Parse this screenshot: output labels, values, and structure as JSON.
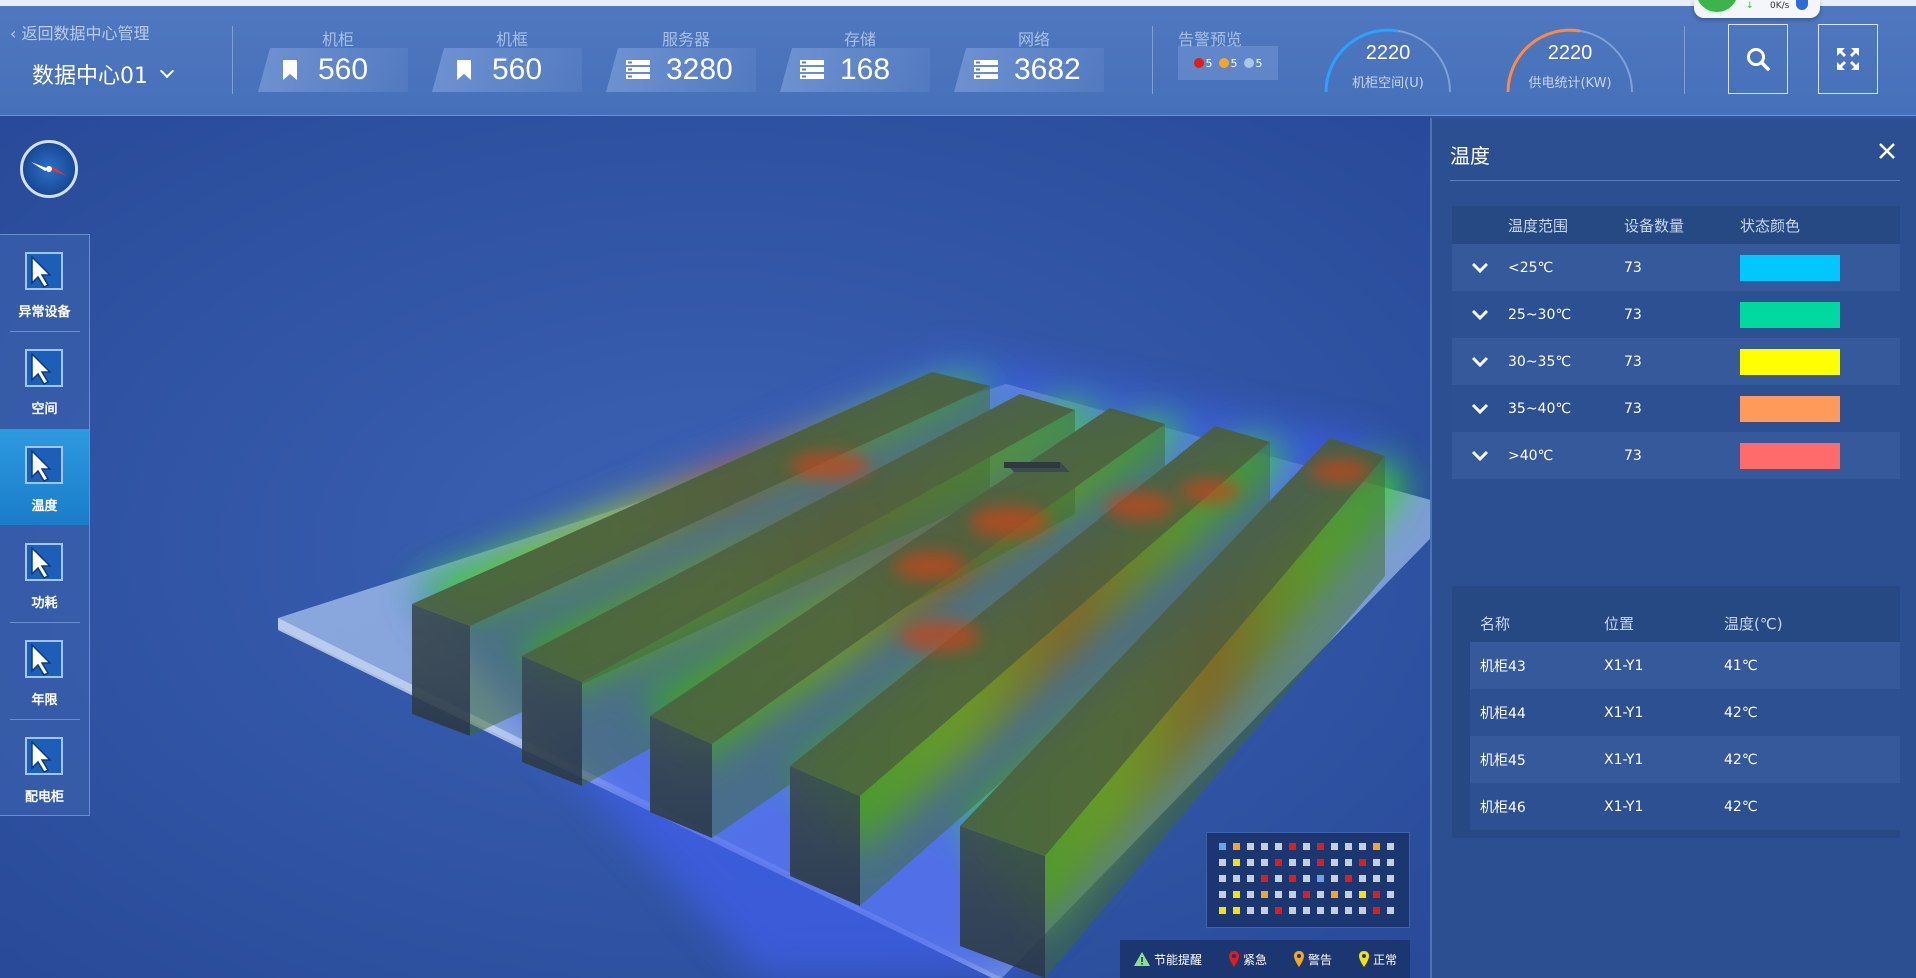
{
  "header": {
    "back_link": "返回数据中心管理",
    "datacenter": "数据中心01",
    "stats": [
      {
        "label": "机柜",
        "value": "560",
        "icon": "bookmark-icon"
      },
      {
        "label": "机框",
        "value": "560",
        "icon": "bookmark-icon"
      },
      {
        "label": "服务器",
        "value": "3280",
        "icon": "server-icon"
      },
      {
        "label": "存储",
        "value": "168",
        "icon": "storage-icon"
      },
      {
        "label": "网络",
        "value": "3682",
        "icon": "network-icon"
      }
    ],
    "alarm": {
      "title": "告警预览",
      "items": [
        {
          "count": "5",
          "color": "#e21b1b"
        },
        {
          "count": "5",
          "color": "#f5a623"
        },
        {
          "count": "5",
          "color": "#a9c7e6"
        }
      ]
    },
    "gauges": [
      {
        "value": "2220",
        "label": "机柜空间(U)",
        "color": "#2ea0ff"
      },
      {
        "value": "2220",
        "label": "供电统计(KW)",
        "color": "#ff8a3d"
      }
    ],
    "speed_text": "0K/s"
  },
  "sidenav": {
    "items": [
      {
        "label": "异常设备",
        "active": false
      },
      {
        "label": "空间",
        "active": false
      },
      {
        "label": "温度",
        "active": true
      },
      {
        "label": "功耗",
        "active": false
      },
      {
        "label": "年限",
        "active": false
      },
      {
        "label": "配电柜",
        "active": false
      }
    ]
  },
  "panel": {
    "title": "温度",
    "range_table": {
      "headers": [
        "温度范围",
        "设备数量",
        "状态颜色"
      ],
      "rows": [
        {
          "range": "<25℃",
          "count": "73",
          "color": "#00c8ff"
        },
        {
          "range": "25~30℃",
          "count": "73",
          "color": "#00d8a0"
        },
        {
          "range": "30~35℃",
          "count": "73",
          "color": "#ffff00"
        },
        {
          "range": "35~40℃",
          "count": "73",
          "color": "#ff9a5a"
        },
        {
          "range": ">40℃",
          "count": "73",
          "color": "#ff6b6b"
        }
      ]
    },
    "cabinet_table": {
      "headers": [
        "名称",
        "位置",
        "温度(℃)"
      ],
      "rows": [
        {
          "name": "机柜43",
          "pos": "X1-Y1",
          "temp": "41℃"
        },
        {
          "name": "机柜44",
          "pos": "X1-Y1",
          "temp": "42℃"
        },
        {
          "name": "机柜45",
          "pos": "X1-Y1",
          "temp": "42℃"
        },
        {
          "name": "机柜46",
          "pos": "X1-Y1",
          "temp": "42℃"
        }
      ]
    }
  },
  "legend": {
    "items": [
      {
        "label": "节能提醒",
        "icon": "warning-triangle-icon",
        "color": "#8fe08a"
      },
      {
        "label": "紧急",
        "icon": "pin-icon",
        "color": "#e21b1b"
      },
      {
        "label": "警告",
        "icon": "pin-icon",
        "color": "#f5a623"
      },
      {
        "label": "正常",
        "icon": "pin-icon",
        "color": "#f5e400"
      }
    ]
  }
}
